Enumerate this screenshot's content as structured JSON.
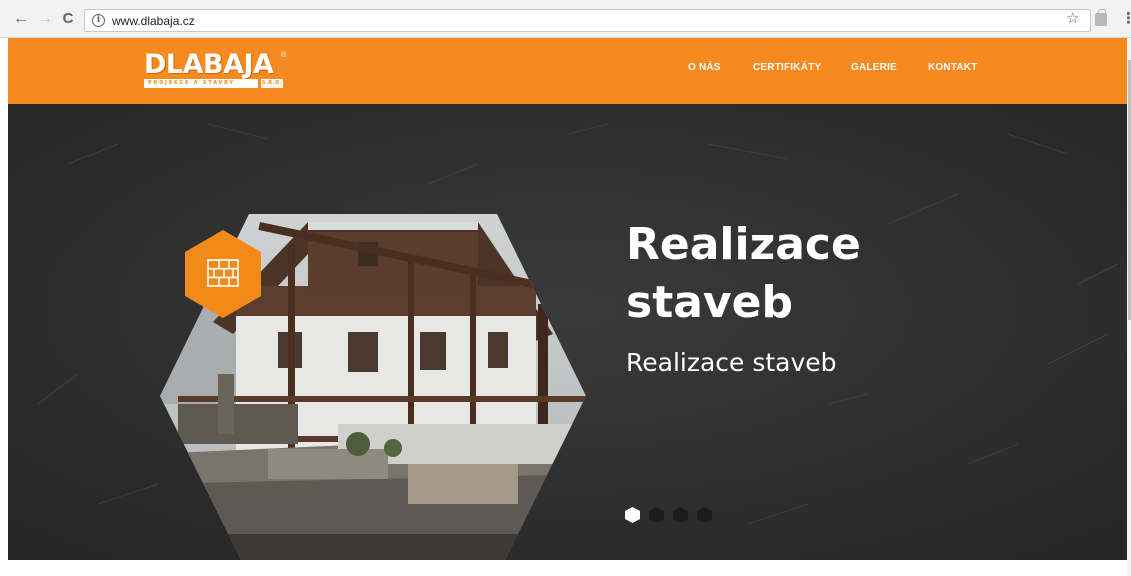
{
  "browser": {
    "url": "www.dlabaja.cz",
    "back_icon": "arrow-left-icon",
    "forward_icon": "arrow-right-icon",
    "reload_icon": "reload-icon",
    "info_icon": "info-icon",
    "bookmark_icon": "star-icon",
    "menu_icon": "kebab-menu-icon",
    "back_glyph": "←",
    "forward_glyph": "→",
    "reload_glyph": "C",
    "info_glyph": "i",
    "star_glyph": "☆",
    "menu_glyph": "⋮"
  },
  "header": {
    "logo": {
      "name": "DLABAJA",
      "registered": "®",
      "tagline": "PROJEKCE A STAVBY",
      "legal": "S.R.O."
    },
    "nav": [
      {
        "label": "O NÁS"
      },
      {
        "label": "CERTIFIKÁTY"
      },
      {
        "label": "GALERIE"
      },
      {
        "label": "KONTAKT"
      }
    ],
    "background_color": "#f78a1e"
  },
  "hero": {
    "title": "Realizace staveb",
    "subtitle": "Realizace staveb",
    "badge_icon": "brick-wall-icon",
    "accent_color": "#f28a1a",
    "slides_total": 4,
    "active_slide": 1
  }
}
